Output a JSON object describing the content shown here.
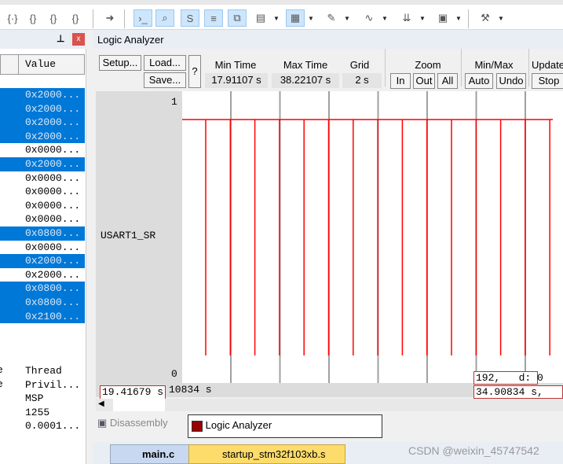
{
  "toolbar": {
    "icons": [
      "brace-step-into-icon",
      "brace-step-over-icon",
      "brace-step-out-icon",
      "brace-run-to-cursor-icon",
      "arrow-right-icon",
      "command-window-icon",
      "disassembly-window-icon",
      "symbols-window-icon",
      "registers-window-icon",
      "call-stack-icon",
      "watch-window-icon",
      "memory-window-icon",
      "serial-window-icon",
      "analysis-window-icon",
      "trace-window-icon",
      "system-viewer-icon",
      "toolbox-icon"
    ]
  },
  "left_panel": {
    "column_value": "Value",
    "rows": [
      {
        "value": "0x2000...",
        "selected": true
      },
      {
        "value": "0x2000...",
        "selected": true
      },
      {
        "value": "0x2000...",
        "selected": true
      },
      {
        "value": "0x2000...",
        "selected": true
      },
      {
        "value": "0x0000...",
        "selected": false
      },
      {
        "value": "0x2000...",
        "selected": true
      },
      {
        "value": "0x0000...",
        "selected": false
      },
      {
        "value": "0x0000...",
        "selected": false
      },
      {
        "value": "0x0000...",
        "selected": false
      },
      {
        "value": "0x0000...",
        "selected": false
      },
      {
        "value": "0x0800...",
        "selected": true
      },
      {
        "value": "0x0000...",
        "selected": false
      },
      {
        "value": "0x2000...",
        "selected": true
      },
      {
        "value": "0x2000...",
        "selected": false
      },
      {
        "value": "0x0800...",
        "selected": true
      },
      {
        "value": "0x0800...",
        "selected": true
      },
      {
        "value": "0x2100...",
        "selected": true
      }
    ],
    "extra": [
      {
        "name": "e",
        "value": "Thread"
      },
      {
        "name": "e",
        "value": "Privil..."
      },
      {
        "name": "",
        "value": "MSP"
      },
      {
        "name": "",
        "value": "1255"
      },
      {
        "name": "",
        "value": "0.0001..."
      }
    ],
    "partial_name": "e"
  },
  "logic_analyzer": {
    "title": "Logic Analyzer",
    "setup": "Setup...",
    "load": "Load...",
    "save": "Save...",
    "help": "?",
    "min_time_label": "Min Time",
    "min_time": "17.91107 s",
    "max_time_label": "Max Time",
    "max_time": "38.22107 s",
    "grid_label": "Grid",
    "grid": "2 s",
    "zoom_label": "Zoom",
    "zoom_in": "In",
    "zoom_out": "Out",
    "zoom_all": "All",
    "minmax_label": "Min/Max",
    "auto": "Auto",
    "undo": "Undo",
    "update_label": "Update",
    "stop": "Stop",
    "signal_name": "USART1_SR",
    "y_max": "1",
    "y_min": "0",
    "cursor_value": "192,   d: 0",
    "left_time": "19.41679 s",
    "mid_time": "10834 s",
    "cursor_time": "34.90834 s,   d:",
    "colors": {
      "signal": "#ff0000",
      "cursor": "#0000ff",
      "grid": "#a0a0a0"
    }
  },
  "chart_data": {
    "type": "line",
    "signal": "USART1_SR",
    "xlim": [
      17.91107,
      38.22107
    ],
    "grid_step_s": 2,
    "ylim": [
      0,
      1
    ],
    "note_levels": "high with short drops to 0",
    "drop_times_s": [
      18.85,
      19.85,
      20.85,
      21.85,
      22.85,
      23.85,
      24.85,
      25.85,
      26.85,
      27.85,
      28.85,
      29.85,
      30.85,
      31.85,
      32.85,
      33.85,
      34.85,
      35.85,
      36.85
    ],
    "cursor_time_s": 34.90834
  },
  "bottom_tabs": [
    {
      "label": "Disassembly",
      "active": false
    },
    {
      "label": "Logic Analyzer",
      "active": true
    }
  ],
  "file_tabs": [
    {
      "label": "main.c",
      "active": true
    },
    {
      "label": "startup_stm32f103xb.s",
      "active": false
    }
  ],
  "watermark": "CSDN @weixin_45747542"
}
